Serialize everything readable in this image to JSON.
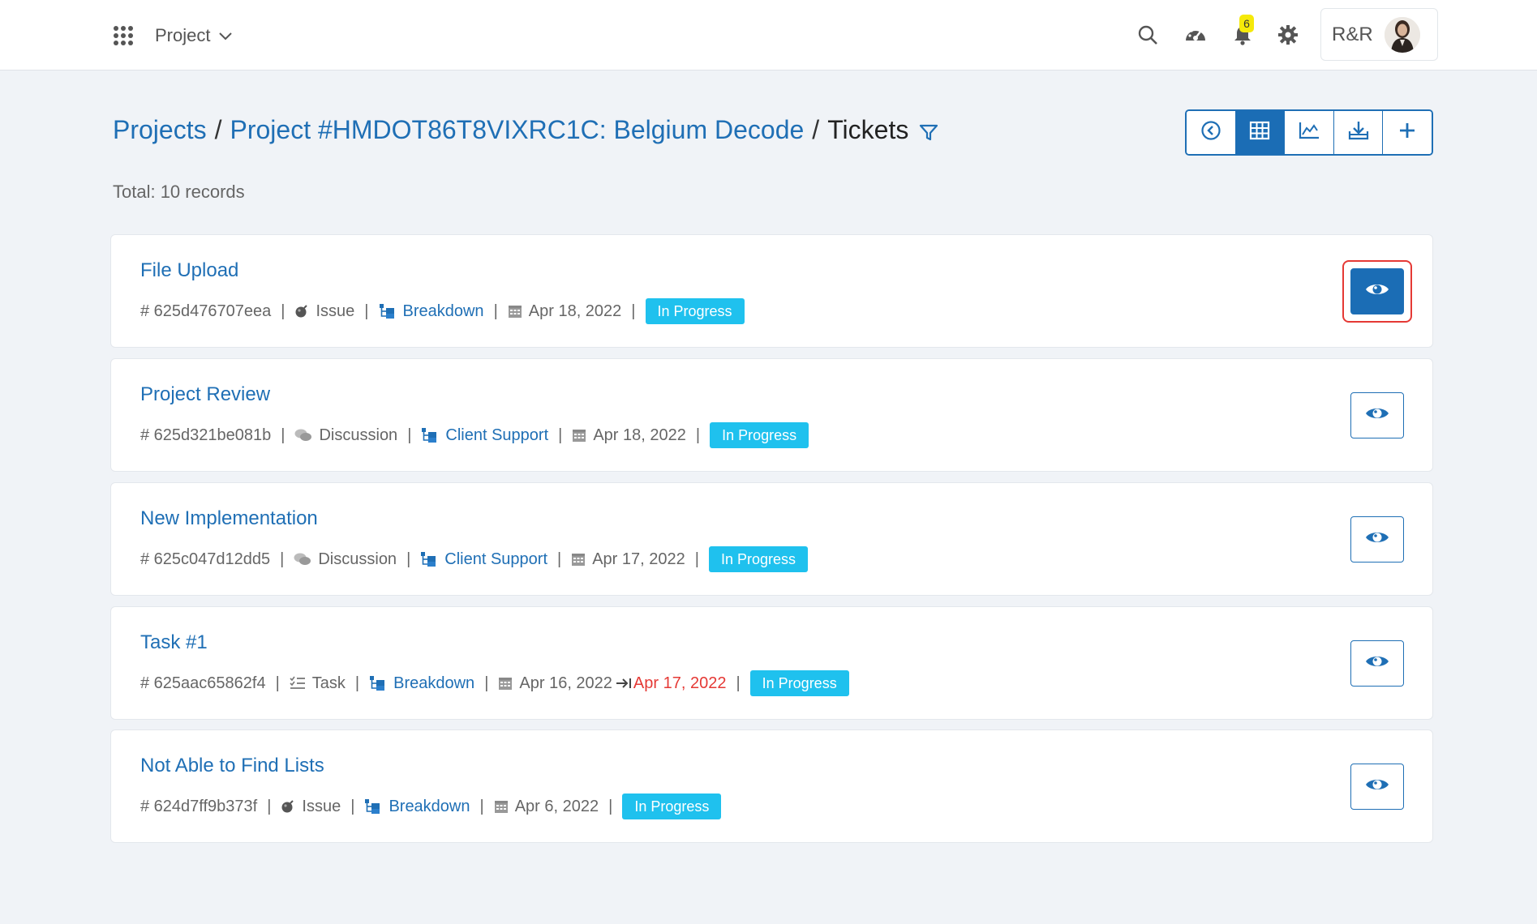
{
  "header": {
    "project_menu_label": "Project",
    "notification_count": "6",
    "user_initials": "R&R"
  },
  "breadcrumb": {
    "projects": "Projects",
    "project": "Project #HMDOT86T8VIXRC1C: Belgium Decode",
    "current": "Tickets",
    "separator": "/"
  },
  "total_label": "Total: 10 records",
  "colors": {
    "accent": "#1f6fb5",
    "status": "#1fc1ee",
    "overdue": "#e53935"
  },
  "tickets": [
    {
      "title": "File Upload",
      "id": "# 625d476707eea",
      "type": "Issue",
      "type_icon": "bomb-icon",
      "category": "Breakdown",
      "date": "Apr 18, 2022",
      "due": "",
      "status": "In Progress"
    },
    {
      "title": "Project Review",
      "id": "# 625d321be081b",
      "type": "Discussion",
      "type_icon": "comments-icon",
      "category": "Client Support",
      "date": "Apr 18, 2022",
      "due": "",
      "status": "In Progress"
    },
    {
      "title": "New Implementation",
      "id": "# 625c047d12dd5",
      "type": "Discussion",
      "type_icon": "comments-icon",
      "category": "Client Support",
      "date": "Apr 17, 2022",
      "due": "",
      "status": "In Progress"
    },
    {
      "title": "Task #1",
      "id": "# 625aac65862f4",
      "type": "Task",
      "type_icon": "task-list-icon",
      "category": "Breakdown",
      "date": "Apr 16, 2022",
      "due": "Apr 17, 2022",
      "status": "In Progress"
    },
    {
      "title": "Not Able to Find Lists",
      "id": "# 624d7ff9b373f",
      "type": "Issue",
      "type_icon": "bomb-icon",
      "category": "Breakdown",
      "date": "Apr 6, 2022",
      "due": "",
      "status": "In Progress"
    }
  ]
}
